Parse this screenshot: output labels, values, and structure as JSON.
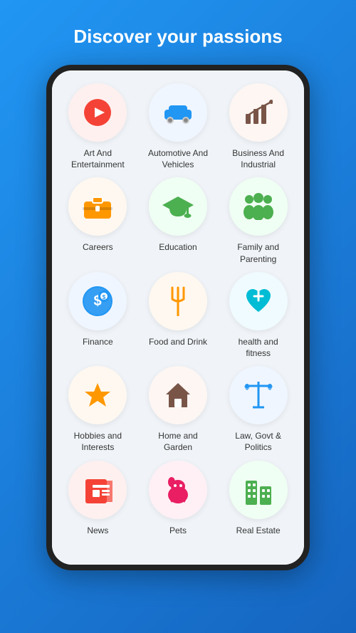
{
  "page": {
    "title": "Discover your passions",
    "background_gradient_start": "#2196F3",
    "background_gradient_end": "#1565C0"
  },
  "categories": [
    {
      "id": "art-entertainment",
      "label": "Art And\nEntertainment",
      "icon": "play",
      "icon_color": "#F44336",
      "bg_color": "#fff0f0"
    },
    {
      "id": "automotive-vehicles",
      "label": "Automotive And\nVehicles",
      "icon": "car",
      "icon_color": "#2196F3",
      "bg_color": "#f0f6ff"
    },
    {
      "id": "business-industrial",
      "label": "Business And\nIndustrial",
      "icon": "chart",
      "icon_color": "#795548",
      "bg_color": "#fdf6f3"
    },
    {
      "id": "careers",
      "label": "Careers",
      "icon": "briefcase",
      "icon_color": "#FF9800",
      "bg_color": "#fff8f0"
    },
    {
      "id": "education",
      "label": "Education",
      "icon": "graduation",
      "icon_color": "#4CAF50",
      "bg_color": "#f0fff3"
    },
    {
      "id": "family-parenting",
      "label": "Family and\nParenting",
      "icon": "family",
      "icon_color": "#4CAF50",
      "bg_color": "#f0fff3"
    },
    {
      "id": "finance",
      "label": "Finance",
      "icon": "dollar",
      "icon_color": "#2196F3",
      "bg_color": "#f0f6ff"
    },
    {
      "id": "food-drink",
      "label": "Food and Drink",
      "icon": "fork",
      "icon_color": "#FF9800",
      "bg_color": "#fff8f0"
    },
    {
      "id": "health-fitness",
      "label": "health and\nfitness",
      "icon": "heart-plus",
      "icon_color": "#00BCD4",
      "bg_color": "#f0fbff"
    },
    {
      "id": "hobbies-interests",
      "label": "Hobbies and\nInterests",
      "icon": "star",
      "icon_color": "#FF9800",
      "bg_color": "#fff8f0"
    },
    {
      "id": "home-garden",
      "label": "Home and\nGarden",
      "icon": "house",
      "icon_color": "#795548",
      "bg_color": "#fdf6f3"
    },
    {
      "id": "law-govt-politics",
      "label": "Law, Govt &\nPolitics",
      "icon": "scales",
      "icon_color": "#2196F3",
      "bg_color": "#f0f6ff"
    },
    {
      "id": "news",
      "label": "News",
      "icon": "newspaper",
      "icon_color": "#F44336",
      "bg_color": "#fff0f0"
    },
    {
      "id": "pets",
      "label": "Pets",
      "icon": "dog",
      "icon_color": "#E91E63",
      "bg_color": "#fff0f5"
    },
    {
      "id": "real-estate",
      "label": "Real Estate",
      "icon": "building",
      "icon_color": "#4CAF50",
      "bg_color": "#f0fff3"
    }
  ]
}
